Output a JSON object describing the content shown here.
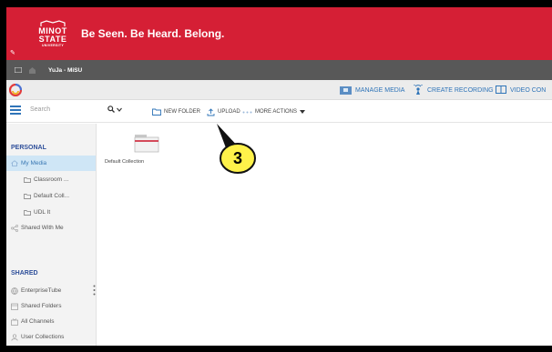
{
  "banner": {
    "logo": {
      "line1": "MINOT",
      "line2": "STATE",
      "line3": "UNIVERSITY"
    },
    "tagline": "Be Seen. Be Heard. Belong.",
    "edit_icon": "pencil-icon"
  },
  "browser_tab": {
    "title": "YuJa - MiSU"
  },
  "toolbar": {
    "manage_media": "MANAGE MEDIA",
    "create_recording": "CREATE RECORDING",
    "video_conf": "VIDEO CON"
  },
  "subbar": {
    "search_placeholder": "Search",
    "new_folder": "NEW FOLDER",
    "upload": "UPLOAD",
    "more_actions": "MORE ACTIONS"
  },
  "sidebar": {
    "personal_heading": "PERSONAL",
    "personal_items": [
      {
        "label": "My Media"
      },
      {
        "label": "Classroom ..."
      },
      {
        "label": "Default Coll..."
      },
      {
        "label": "UDL It"
      },
      {
        "label": "Shared With Me"
      }
    ],
    "shared_heading": "SHARED",
    "shared_items": [
      {
        "label": "EnterpriseTube"
      },
      {
        "label": "Shared Folders"
      },
      {
        "label": "All Channels"
      },
      {
        "label": "User Collections"
      }
    ]
  },
  "main": {
    "collections": [
      {
        "label": "Default Collection"
      }
    ]
  },
  "callout": {
    "number": "3"
  },
  "colors": {
    "brand_red": "#d51f35",
    "accent_blue": "#2f74b8",
    "callout_yellow": "#fff24a"
  }
}
